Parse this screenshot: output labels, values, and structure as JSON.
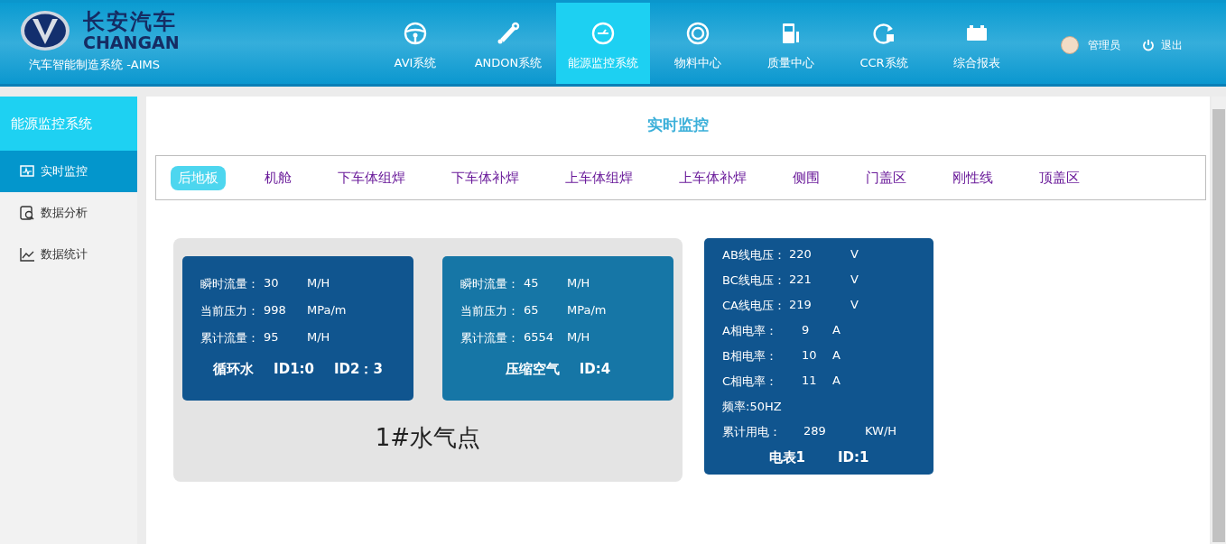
{
  "brand": {
    "name_cn": "长安汽车",
    "name_en": "CHANGAN",
    "subtitle": "汽车智能制造系统 -AIMS"
  },
  "nav": [
    {
      "label": "AVI系统",
      "selected": false
    },
    {
      "label": "ANDON系统",
      "selected": false
    },
    {
      "label": "能源监控系统",
      "selected": true
    },
    {
      "label": "物料中心",
      "selected": false
    },
    {
      "label": "质量中心",
      "selected": false
    },
    {
      "label": "CCR系统",
      "selected": false
    },
    {
      "label": "综合报表",
      "selected": false
    }
  ],
  "user": {
    "name": "管理员",
    "logout": "退出"
  },
  "sidebar": {
    "title": "能源监控系统",
    "items": [
      {
        "label": "实时监控",
        "selected": true
      },
      {
        "label": "数据分析",
        "selected": false
      },
      {
        "label": "数据统计",
        "selected": false
      }
    ]
  },
  "page_title": "实时监控",
  "tabs": [
    {
      "label": "后地板",
      "selected": true
    },
    {
      "label": "机舱",
      "selected": false
    },
    {
      "label": "下车体组焊",
      "selected": false
    },
    {
      "label": "下车体补焊",
      "selected": false
    },
    {
      "label": "上车体组焊",
      "selected": false
    },
    {
      "label": "上车体补焊",
      "selected": false
    },
    {
      "label": "侧围",
      "selected": false
    },
    {
      "label": "门盖区",
      "selected": false
    },
    {
      "label": "刚性线",
      "selected": false
    },
    {
      "label": "顶盖区",
      "selected": false
    }
  ],
  "station": {
    "name": "1#水气点",
    "cards": [
      {
        "color": "#10558f",
        "rows": [
          {
            "label": "瞬时流量：",
            "value": "30",
            "unit": "M/H"
          },
          {
            "label": "当前压力：",
            "value": "998",
            "unit": "MPa/m"
          },
          {
            "label": "累计流量：",
            "value": "95",
            "unit": "M/H"
          }
        ],
        "footer": [
          "循环水",
          "ID1:0",
          "ID2：3"
        ]
      },
      {
        "color": "#1676a6",
        "rows": [
          {
            "label": "瞬时流量：",
            "value": "45",
            "unit": "M/H"
          },
          {
            "label": "当前压力：",
            "value": "65",
            "unit": "MPa/m"
          },
          {
            "label": "累计流量：",
            "value": "6554",
            "unit": "M/H"
          }
        ],
        "footer": [
          "压缩空气",
          "ID:4"
        ]
      }
    ]
  },
  "meter": {
    "rows": [
      {
        "kind": "line",
        "label": "AB线电压：",
        "value": "220",
        "unit": "V"
      },
      {
        "kind": "line",
        "label": "BC线电压：",
        "value": "221",
        "unit": "V"
      },
      {
        "kind": "line",
        "label": "CA线电压：",
        "value": "219",
        "unit": "V"
      },
      {
        "kind": "phase",
        "label": "A相电率：",
        "value": "9",
        "unit": "A"
      },
      {
        "kind": "phase",
        "label": "B相电率：",
        "value": "10",
        "unit": "A"
      },
      {
        "kind": "phase",
        "label": "C相电率：",
        "value": "11",
        "unit": "A"
      },
      {
        "kind": "text",
        "label": "频率:50HZ"
      },
      {
        "kind": "total",
        "label": "累计用电：",
        "value": "289",
        "unit": "KW/H"
      }
    ],
    "footer": [
      "电表1",
      "ID:1"
    ]
  }
}
